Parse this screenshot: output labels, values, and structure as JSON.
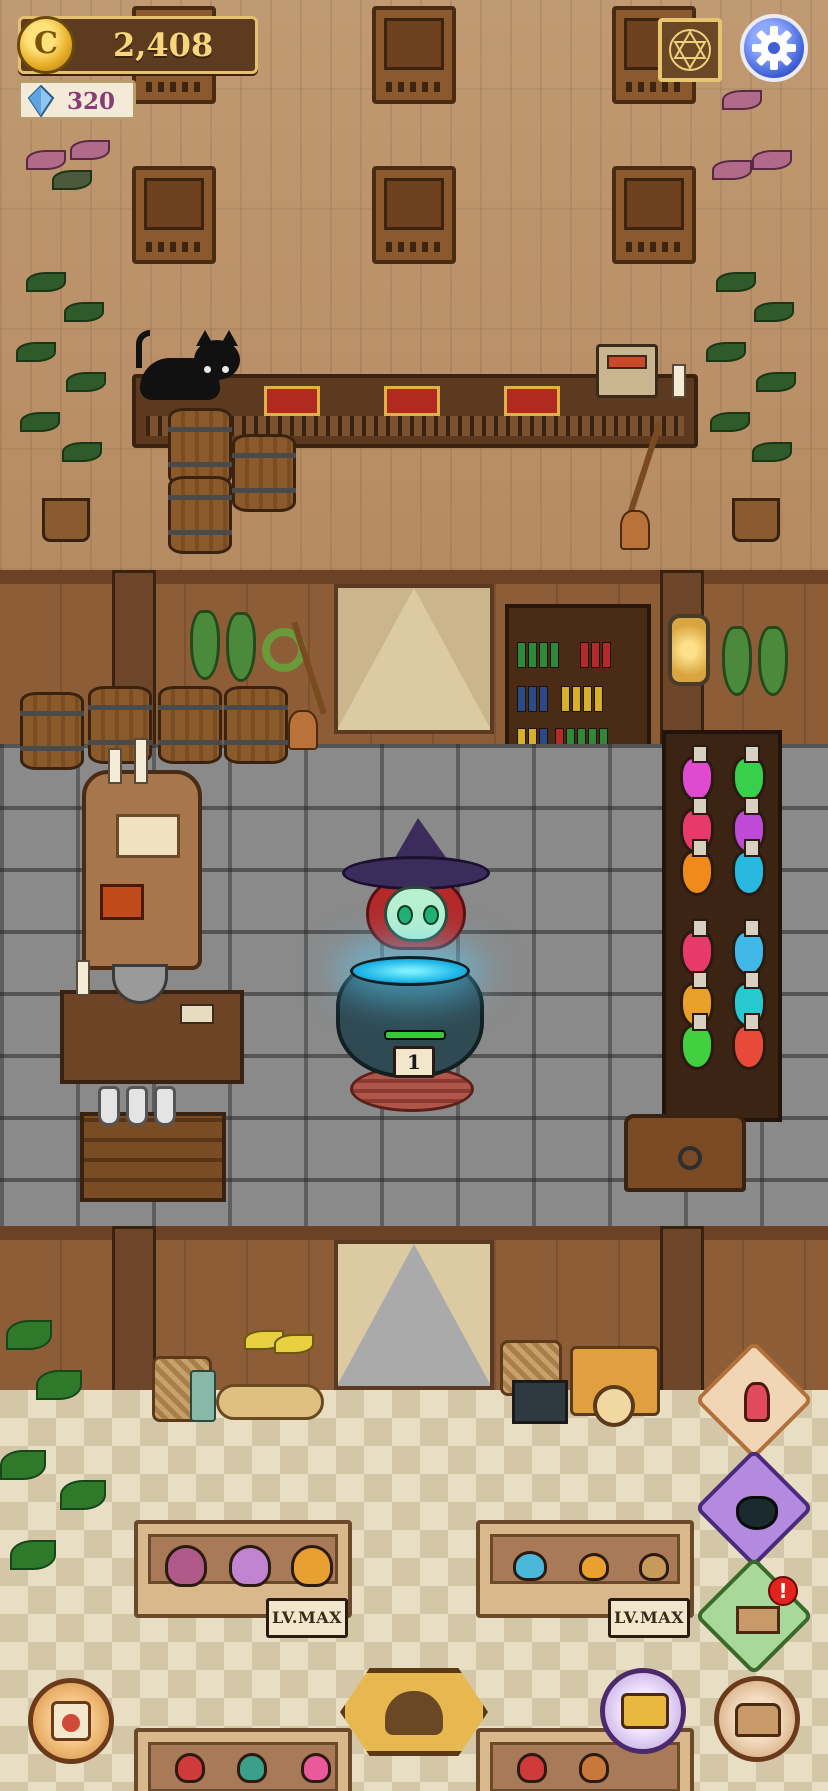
{
  "hud": {
    "coins": "2,408",
    "coin_icon_letter": "C",
    "gems": "320",
    "coin_icon": "gold-coin-icon",
    "gem_icon": "blue-crystal-icon",
    "pentagram_icon": "hexagram-icon",
    "settings_icon": "gear-icon"
  },
  "cauldron": {
    "level": "1",
    "progress": 1.0,
    "brew_color": "#21b8e8"
  },
  "garden": {
    "planters": [
      {
        "level_label": "LV.MAX"
      },
      {
        "level_label": "LV.MAX"
      }
    ]
  },
  "side_menu": {
    "items": [
      {
        "icon": "potion-stand-icon"
      },
      {
        "icon": "cauldron-icon"
      },
      {
        "icon": "garden-bed-icon",
        "alert": "!"
      }
    ]
  },
  "bottom_bar": {
    "left_icon": "recipe-scroll-icon",
    "center_icon": "customers-icon",
    "right_1_icon": "shop-cart-icon",
    "right_2_icon": "storage-chest-icon"
  },
  "colors": {
    "gold": "#f7d77e",
    "gem_text": "#8b3a78",
    "alert": "#e3241c",
    "progress": "#38c83a"
  }
}
